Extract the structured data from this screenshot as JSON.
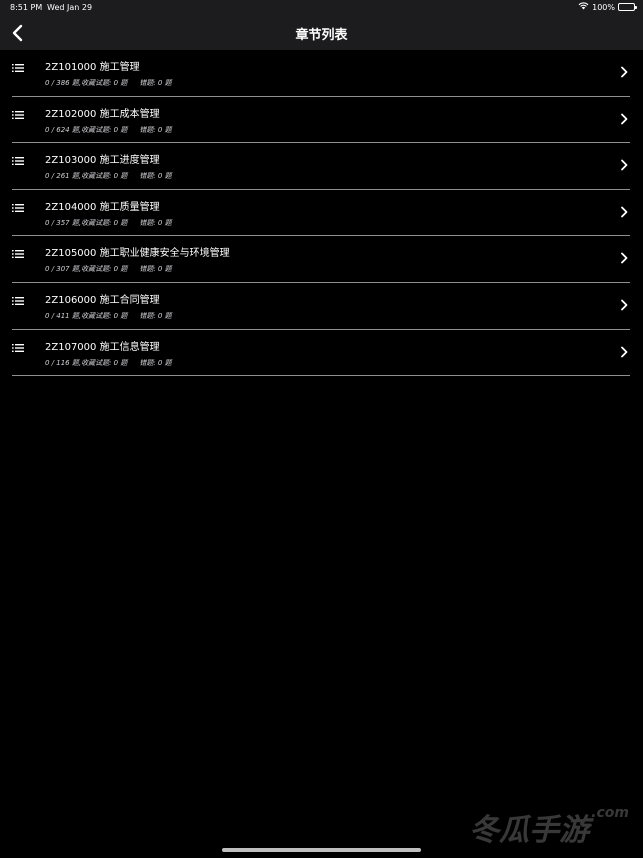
{
  "status_bar": {
    "time": "8:51 PM",
    "date": "Wed Jan 29",
    "battery": "100%",
    "wifi_icon": "wifi-icon"
  },
  "nav": {
    "title": "章节列表",
    "back_icon": "chevron-left-icon"
  },
  "chapters": [
    {
      "title": "2Z101000 施工管理",
      "progress": "0 / 386 题,",
      "favorites": "收藏试题: 0 题",
      "errors": "错题: 0 题"
    },
    {
      "title": "2Z102000 施工成本管理",
      "progress": "0 / 624 题,",
      "favorites": "收藏试题: 0 题",
      "errors": "错题: 0 题"
    },
    {
      "title": "2Z103000 施工进度管理",
      "progress": "0 / 261 题,",
      "favorites": "收藏试题: 0 题",
      "errors": "错题: 0 题"
    },
    {
      "title": "2Z104000 施工质量管理",
      "progress": "0 / 357 题,",
      "favorites": "收藏试题: 0 题",
      "errors": "错题: 0 题"
    },
    {
      "title": "2Z105000 施工职业健康安全与环境管理",
      "progress": "0 / 307 题,",
      "favorites": "收藏试题: 0 题",
      "errors": "错题: 0 题"
    },
    {
      "title": "2Z106000 施工合同管理",
      "progress": "0 / 411 题,",
      "favorites": "收藏试题: 0 题",
      "errors": "错题: 0 题"
    },
    {
      "title": "2Z107000 施工信息管理",
      "progress": "0 / 116 题,",
      "favorites": "收藏试题: 0 题",
      "errors": "错题: 0 题"
    }
  ],
  "watermark": {
    "brand": "冬瓜手游",
    "domain": ".com"
  }
}
